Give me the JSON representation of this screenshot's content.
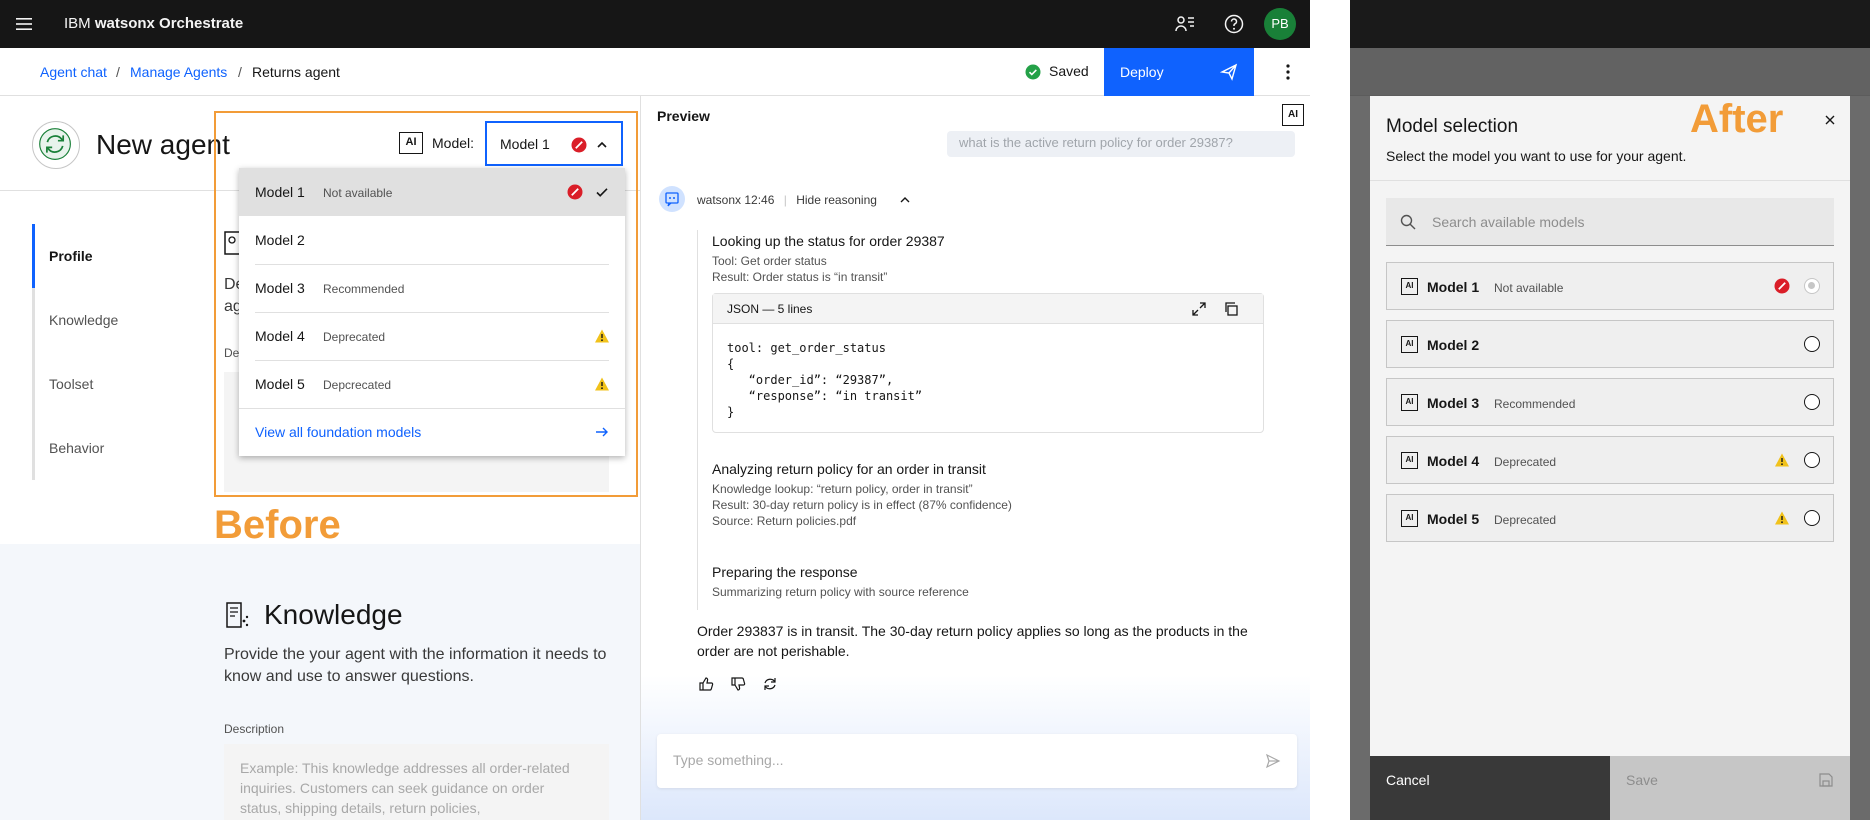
{
  "topbar": {
    "brand_prefix": "IBM",
    "brand_name": "watsonx Orchestrate",
    "avatar_initials": "PB"
  },
  "breadcrumb": {
    "items": [
      "Agent chat",
      "Manage Agents",
      "Returns agent"
    ],
    "separator": "/"
  },
  "status": {
    "saved_label": "Saved"
  },
  "deploy": {
    "label": "Deploy"
  },
  "agent": {
    "title": "New agent",
    "model_label": "Model:",
    "model_ai_badge": "AI",
    "model_value": "Model 1"
  },
  "sidenav": {
    "items": [
      "Profile",
      "Knowledge",
      "Toolset",
      "Behavior"
    ],
    "active": "Profile"
  },
  "profile_stub": {
    "desc_line1": "De",
    "desc_line2": "ag",
    "field_label": "De"
  },
  "knowledge": {
    "title": "Knowledge",
    "description": "Provide the your agent with the information it needs to know and use to answer questions.",
    "field_label": "Description",
    "placeholder": "Example: This knowledge addresses all order-related inquiries. Customers can seek guidance on order status, shipping details, return policies,"
  },
  "dropdown": {
    "items": [
      {
        "name": "Model 1",
        "status": "Not available",
        "icon": "error-icon",
        "selected": true
      },
      {
        "name": "Model 2",
        "status": "",
        "icon": "",
        "selected": false
      },
      {
        "name": "Model 3",
        "status": "Recommended",
        "icon": "",
        "selected": false
      },
      {
        "name": "Model 4",
        "status": "Deprecated",
        "icon": "warning-icon",
        "selected": false
      },
      {
        "name": "Model 5",
        "status": "Depcrecated",
        "icon": "warning-icon",
        "selected": false
      }
    ],
    "link": "View all foundation models"
  },
  "labels": {
    "before": "Before",
    "after": "After"
  },
  "preview": {
    "title": "Preview",
    "ai_badge": "AI",
    "ghost_user_msg": "what is the active return policy for order 29387?",
    "bot_name": "watsonx",
    "bot_time": "12:46",
    "reasoning_toggle": "Hide reasoning",
    "steps": [
      {
        "title": "Looking up the status for order 29387",
        "lines": [
          "Tool: Get order status",
          "Result: Order status is “in transit”"
        ]
      },
      {
        "title": "Analyzing return policy for an order in transit",
        "lines": [
          "Knowledge lookup: “return policy, order in transit”",
          "Result: 30-day return policy is in effect (87% confidence)",
          "Source: Return policies.pdf"
        ]
      },
      {
        "title": "Preparing the response",
        "lines": [
          "Summarizing return policy with source reference"
        ]
      }
    ],
    "code": {
      "header": "JSON — 5 lines",
      "body": "tool: get_order_status\n{\n   “order_id”: “29387”,\n   “response”: “in transit”\n}"
    },
    "answer": "Order 293837 is in transit. The 30-day return policy applies so long as the products in the order are not perishable.",
    "input_placeholder": "Type something..."
  },
  "modal": {
    "title": "Model selection",
    "subtitle": "Select the model you want to use for your agent.",
    "search_placeholder": "Search available models",
    "options": [
      {
        "name": "Model 1",
        "status": "Not available",
        "icon": "error-icon",
        "disabled": true
      },
      {
        "name": "Model 2",
        "status": "",
        "icon": "",
        "disabled": false
      },
      {
        "name": "Model 3",
        "status": "Recommended",
        "icon": "",
        "disabled": false
      },
      {
        "name": "Model 4",
        "status": "Deprecated",
        "icon": "warning-icon",
        "disabled": false
      },
      {
        "name": "Model 5",
        "status": "Deprecated",
        "icon": "warning-icon",
        "disabled": false
      }
    ],
    "option_ai_badge": "AI",
    "cancel_label": "Cancel",
    "save_label": "Save"
  },
  "colors": {
    "primary": "#0f62fe",
    "annotation": "#f29c38",
    "error": "#da1e28",
    "warning": "#f1c21b",
    "success": "#24a148",
    "avatar": "#198038"
  }
}
